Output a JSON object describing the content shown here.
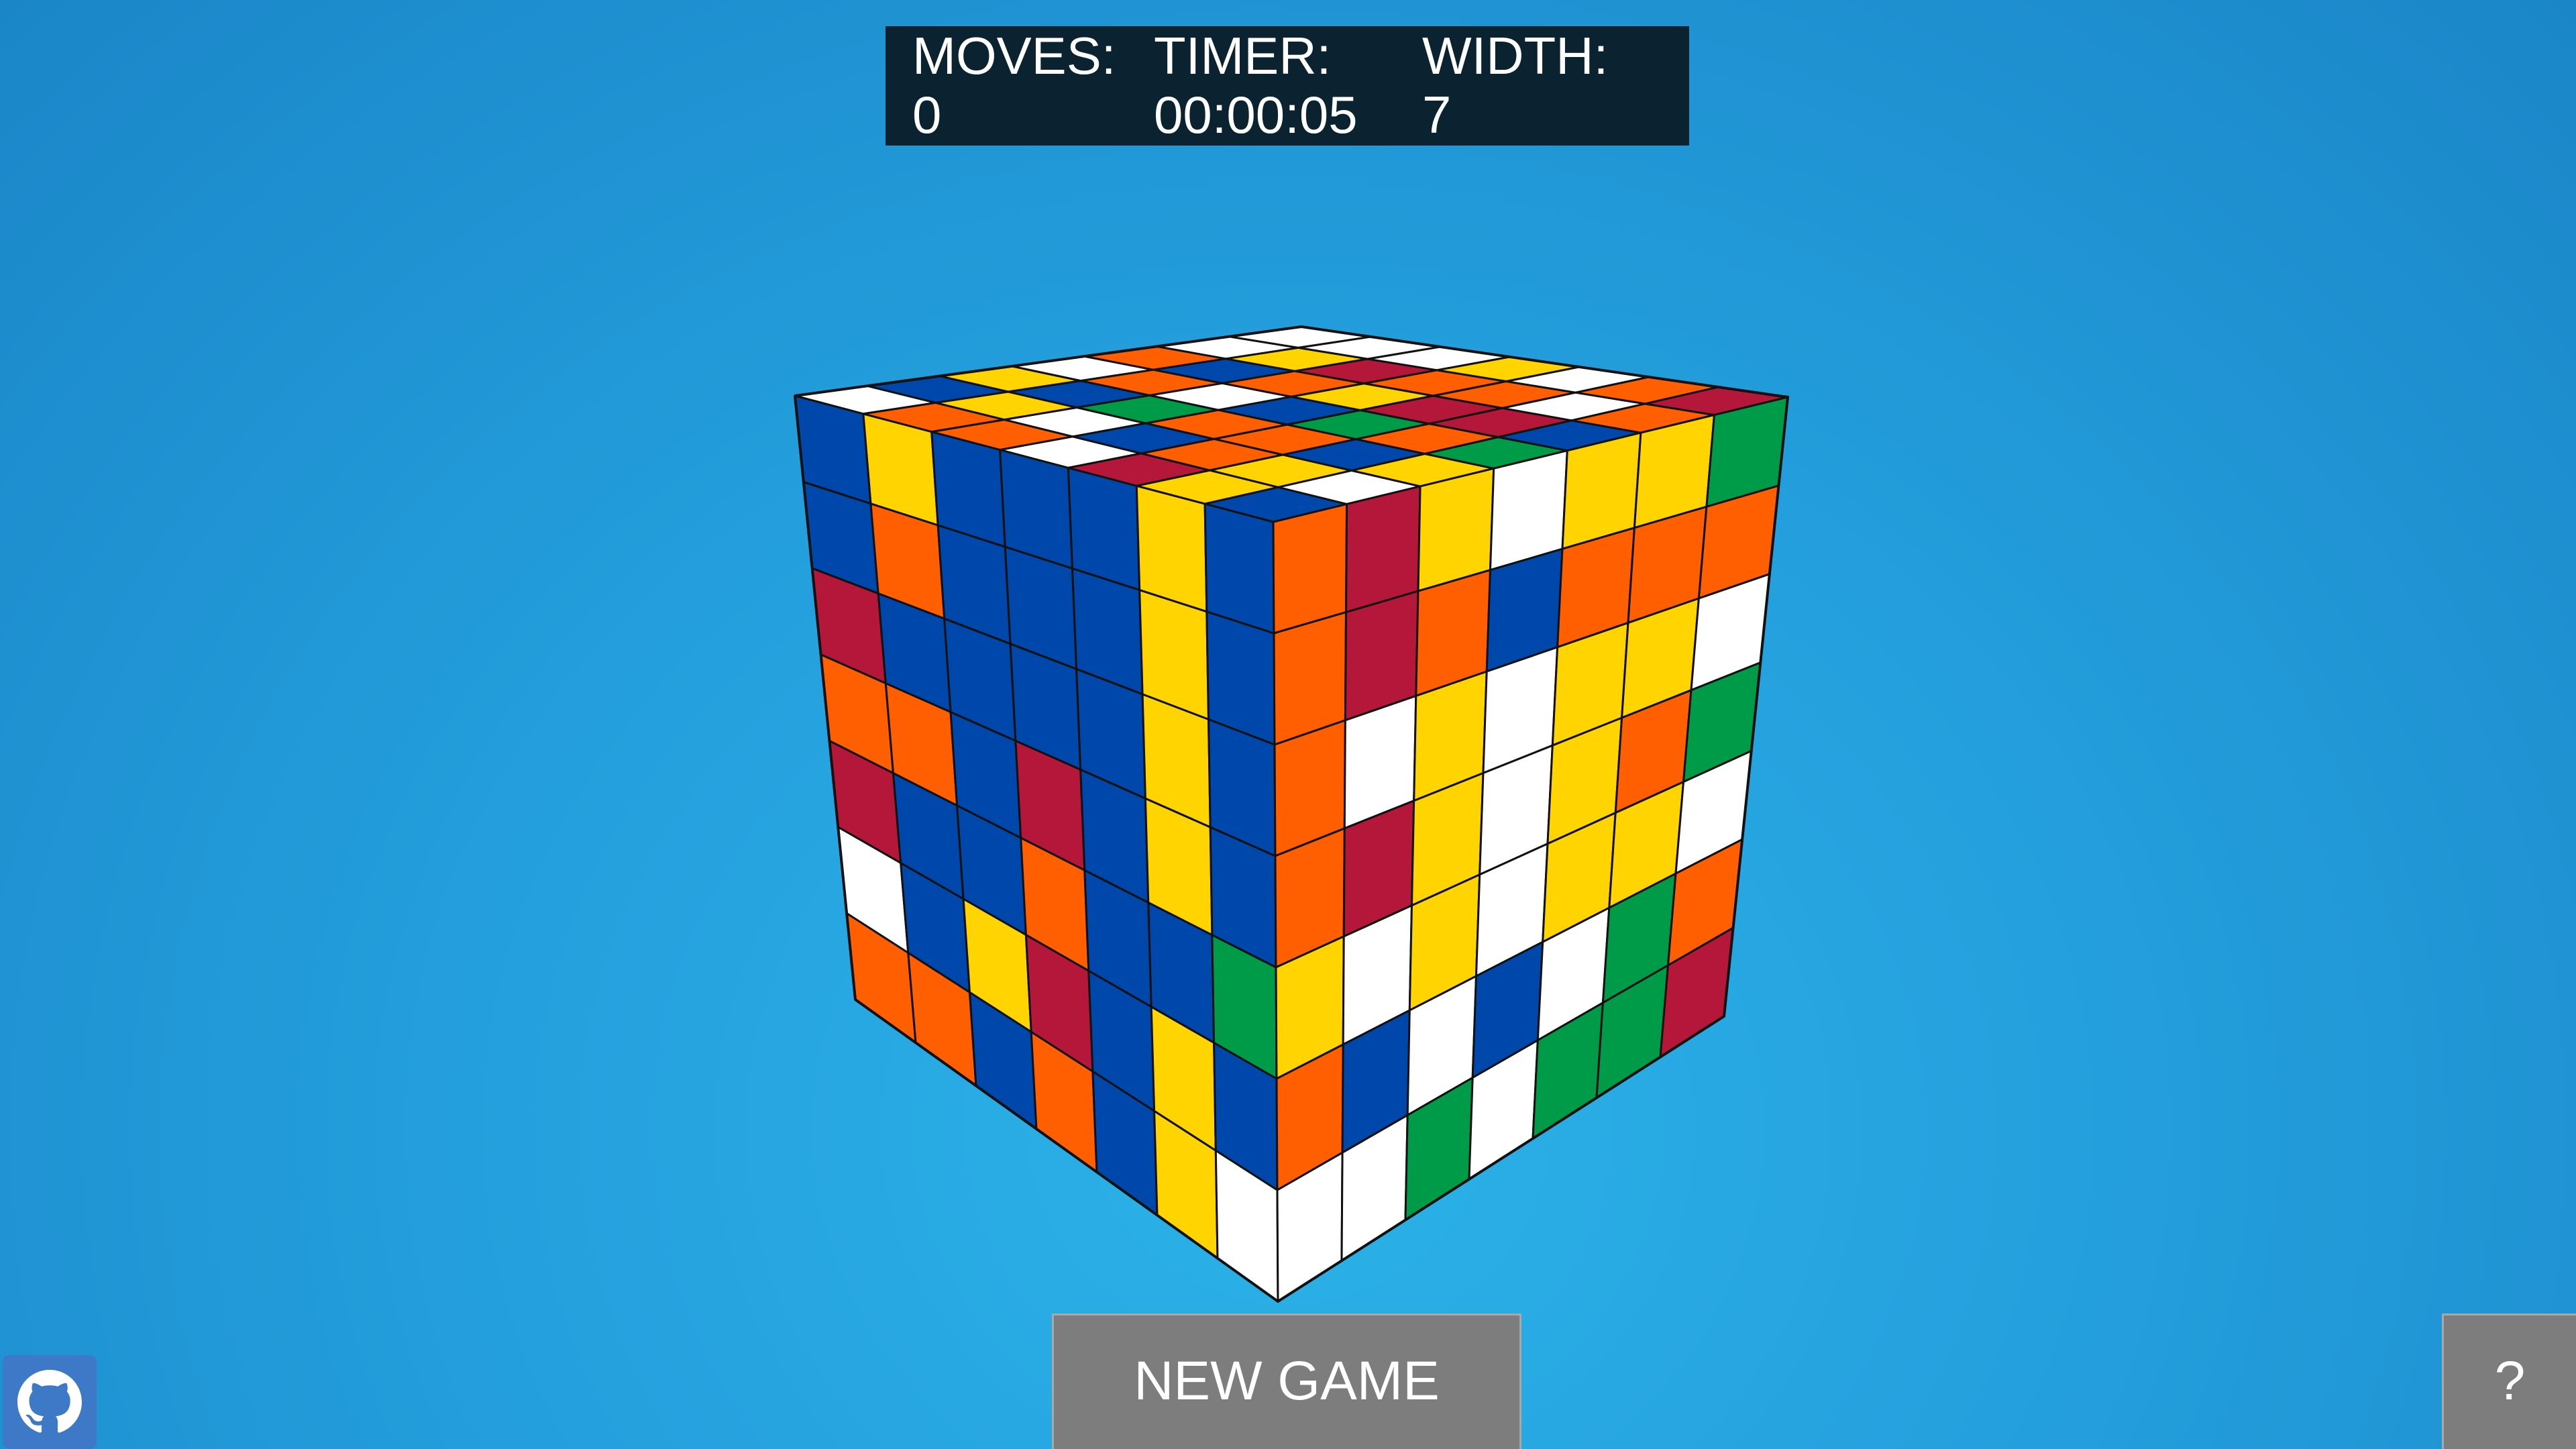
{
  "stats": {
    "moves_label": "MOVES:",
    "moves_value": "0",
    "timer_label": "TIMER:",
    "timer_value": "00:00:05",
    "width_label": "WIDTH:",
    "width_value": "7"
  },
  "buttons": {
    "new_game": "NEW GAME",
    "help": "?"
  },
  "github_link": {
    "icon": "github-icon"
  },
  "colors": {
    "W": "#ffffff",
    "Y": "#ffd400",
    "B": "#0047ab",
    "R": "#b5173a",
    "O": "#ff5f00",
    "G": "#009b48"
  },
  "cube": {
    "size": 7,
    "faces": {
      "top": [
        [
          "W",
          "B",
          "Y",
          "W",
          "O",
          "W",
          "W"
        ],
        [
          "O",
          "Y",
          "B",
          "O",
          "B",
          "Y",
          "W"
        ],
        [
          "O",
          "W",
          "G",
          "W",
          "O",
          "R",
          "W"
        ],
        [
          "W",
          "B",
          "O",
          "B",
          "Y",
          "O",
          "Y"
        ],
        [
          "R",
          "O",
          "O",
          "G",
          "R",
          "O",
          "W"
        ],
        [
          "Y",
          "Y",
          "B",
          "O",
          "R",
          "W",
          "O"
        ],
        [
          "B",
          "W",
          "Y",
          "G",
          "B",
          "O",
          "R"
        ]
      ],
      "left": [
        [
          "B",
          "Y",
          "B",
          "B",
          "B",
          "Y",
          "B"
        ],
        [
          "B",
          "O",
          "B",
          "B",
          "B",
          "Y",
          "B"
        ],
        [
          "R",
          "B",
          "B",
          "B",
          "B",
          "Y",
          "B"
        ],
        [
          "O",
          "O",
          "B",
          "R",
          "B",
          "Y",
          "B"
        ],
        [
          "R",
          "B",
          "B",
          "O",
          "B",
          "B",
          "G"
        ],
        [
          "W",
          "B",
          "Y",
          "R",
          "B",
          "Y",
          "B"
        ],
        [
          "O",
          "O",
          "B",
          "O",
          "B",
          "Y",
          "W"
        ]
      ],
      "right": [
        [
          "O",
          "R",
          "Y",
          "W",
          "Y",
          "Y",
          "G"
        ],
        [
          "O",
          "R",
          "O",
          "B",
          "O",
          "O",
          "O"
        ],
        [
          "O",
          "W",
          "Y",
          "W",
          "Y",
          "Y",
          "W"
        ],
        [
          "O",
          "R",
          "Y",
          "W",
          "Y",
          "O",
          "G"
        ],
        [
          "Y",
          "W",
          "Y",
          "W",
          "Y",
          "Y",
          "W"
        ],
        [
          "O",
          "B",
          "W",
          "B",
          "W",
          "G",
          "O"
        ],
        [
          "W",
          "W",
          "G",
          "W",
          "G",
          "G",
          "R"
        ]
      ]
    }
  }
}
